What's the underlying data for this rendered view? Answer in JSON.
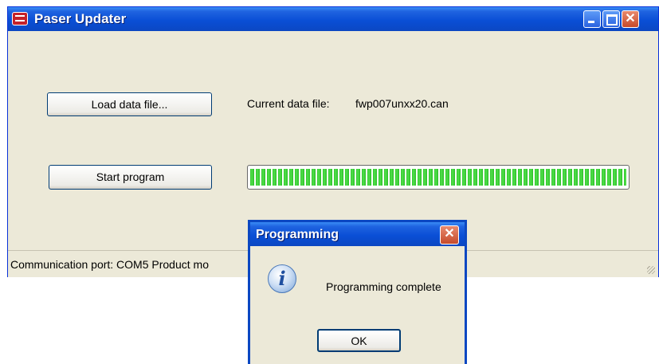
{
  "window": {
    "title": "Paser Updater",
    "load_button": "Load data file...",
    "current_file_label": "Current data file:",
    "current_file_value": "fwp007unxx20.can",
    "start_button": "Start program",
    "progress_fraction": 1.0,
    "status_text": "Communication port:  COM5  Product mo"
  },
  "dialog": {
    "title": "Programming",
    "message": "Programming complete",
    "ok_button": "OK",
    "icon": "info-icon"
  },
  "colors": {
    "titlebar": "#0a4fd6",
    "window_bg": "#ece9d8",
    "progress": "#2fc52c",
    "close": "#c64a2b"
  }
}
